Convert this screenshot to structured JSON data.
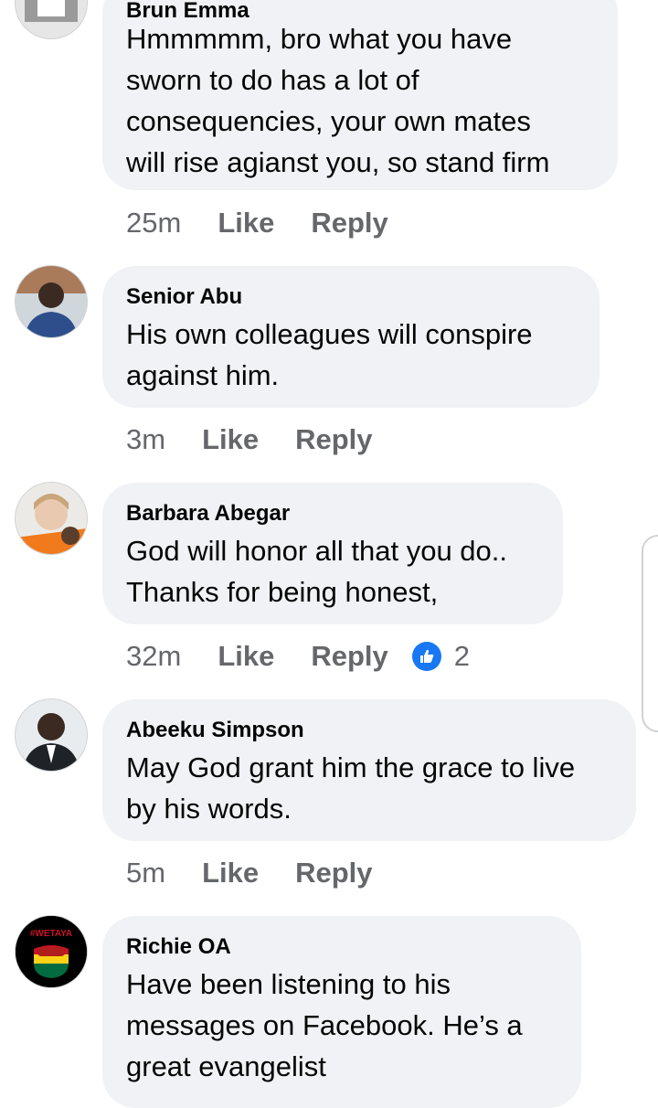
{
  "comments": [
    {
      "name": "Brun Emma",
      "text": "Hmmmmm, bro what you have\nsworn to do has a lot of\nconsequencies, your own mates\nwill rise agianst you, so stand firm",
      "time": "25m",
      "like": "Like",
      "reply": "Reply"
    },
    {
      "name": "Senior Abu",
      "text": "His own colleagues will conspire\nagainst him.",
      "time": "3m",
      "like": "Like",
      "reply": "Reply"
    },
    {
      "name": "Barbara Abegar",
      "text": "God will honor all that you do..\nThanks for being honest,",
      "time": "32m",
      "like": "Like",
      "reply": "Reply",
      "reaction_count": "2",
      "reaction_icon": "thumbs-up-icon"
    },
    {
      "name": "Abeeku Simpson",
      "text": "May God grant him the grace to live\nby his words.",
      "time": "5m",
      "like": "Like",
      "reply": "Reply"
    },
    {
      "name": "Richie OA",
      "text": "Have been listening to his\nmessages on Facebook. He’s a\ngreat evangelist",
      "avatar_text": "#WETAYA"
    }
  ],
  "colors": {
    "bubble": "#f0f2f5",
    "meta": "#65676b",
    "reaction": "#1877f2"
  }
}
